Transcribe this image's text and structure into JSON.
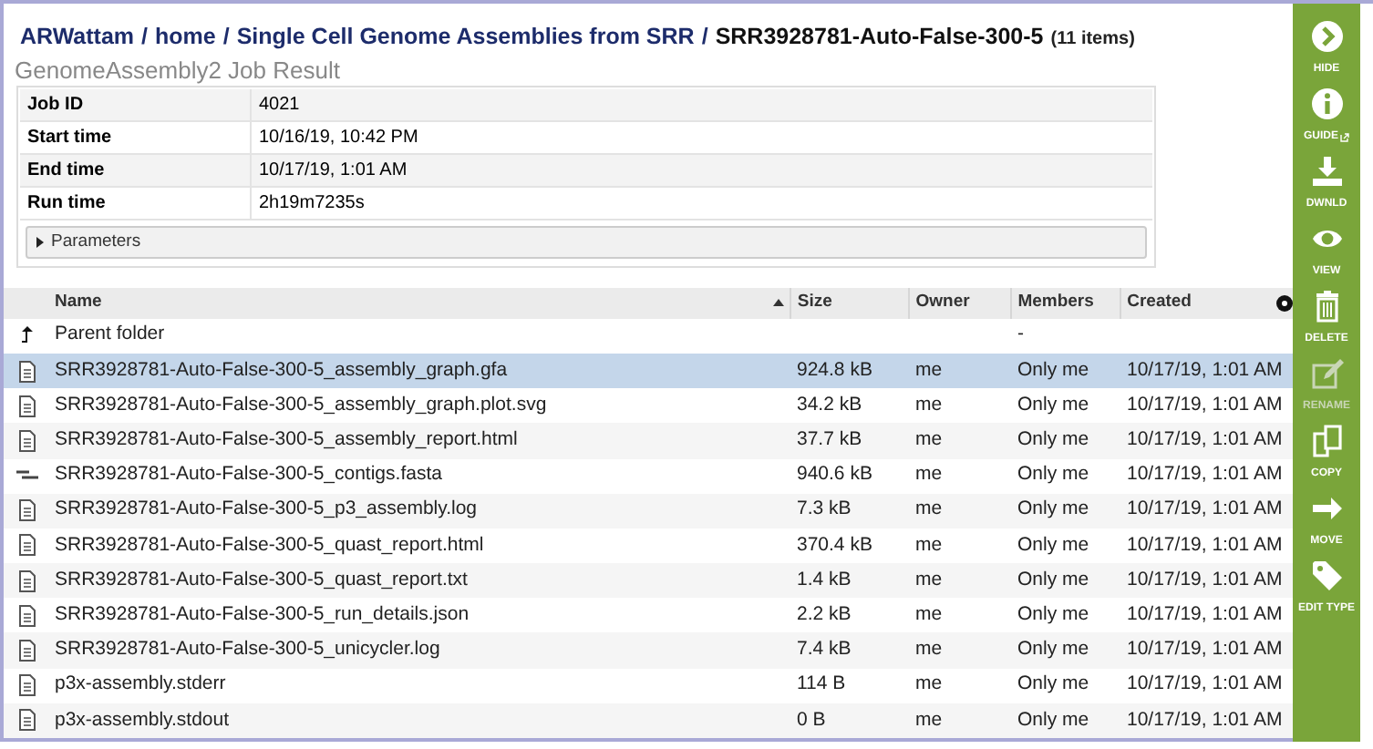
{
  "breadcrumb": {
    "path": [
      {
        "label": "ARWattam"
      },
      {
        "label": "home"
      },
      {
        "label": "Single Cell Genome Assemblies from SRR"
      }
    ],
    "separator": "/",
    "current": "SRR3928781-Auto-False-300-5",
    "count": "(11 items)"
  },
  "job": {
    "title": "GenomeAssembly2 Job Result",
    "rows": [
      {
        "label": "Job ID",
        "value": "4021"
      },
      {
        "label": "Start time",
        "value": "10/16/19, 10:42 PM"
      },
      {
        "label": "End time",
        "value": "10/17/19, 1:01 AM"
      },
      {
        "label": "Run time",
        "value": "2h19m7235s"
      }
    ],
    "parameters": {
      "label": "Parameters",
      "expanded": false
    }
  },
  "table": {
    "columns": [
      {
        "label": "Name",
        "sorted": true
      },
      {
        "label": "Size",
        "sorted": false
      },
      {
        "label": "Owner",
        "sorted": false
      },
      {
        "label": "Members",
        "sorted": false
      },
      {
        "label": "Created",
        "sorted": false
      }
    ],
    "rows": [
      {
        "kind": "parent",
        "name": "Parent folder",
        "size": "",
        "owner": "",
        "members": "-",
        "created": "",
        "selected": false
      },
      {
        "kind": "file",
        "name": "SRR3928781-Auto-False-300-5_assembly_graph.gfa",
        "size": "924.8 kB",
        "owner": "me",
        "members": "Only me",
        "created": "10/17/19, 1:01 AM",
        "selected": true
      },
      {
        "kind": "file",
        "name": "SRR3928781-Auto-False-300-5_assembly_graph.plot.svg",
        "size": "34.2 kB",
        "owner": "me",
        "members": "Only me",
        "created": "10/17/19, 1:01 AM",
        "selected": false
      },
      {
        "kind": "file",
        "name": "SRR3928781-Auto-False-300-5_assembly_report.html",
        "size": "37.7 kB",
        "owner": "me",
        "members": "Only me",
        "created": "10/17/19, 1:01 AM",
        "selected": false
      },
      {
        "kind": "contigs",
        "name": "SRR3928781-Auto-False-300-5_contigs.fasta",
        "size": "940.6 kB",
        "owner": "me",
        "members": "Only me",
        "created": "10/17/19, 1:01 AM",
        "selected": false
      },
      {
        "kind": "file",
        "name": "SRR3928781-Auto-False-300-5_p3_assembly.log",
        "size": "7.3 kB",
        "owner": "me",
        "members": "Only me",
        "created": "10/17/19, 1:01 AM",
        "selected": false
      },
      {
        "kind": "file",
        "name": "SRR3928781-Auto-False-300-5_quast_report.html",
        "size": "370.4 kB",
        "owner": "me",
        "members": "Only me",
        "created": "10/17/19, 1:01 AM",
        "selected": false
      },
      {
        "kind": "file",
        "name": "SRR3928781-Auto-False-300-5_quast_report.txt",
        "size": "1.4 kB",
        "owner": "me",
        "members": "Only me",
        "created": "10/17/19, 1:01 AM",
        "selected": false
      },
      {
        "kind": "file",
        "name": "SRR3928781-Auto-False-300-5_run_details.json",
        "size": "2.2 kB",
        "owner": "me",
        "members": "Only me",
        "created": "10/17/19, 1:01 AM",
        "selected": false
      },
      {
        "kind": "file",
        "name": "SRR3928781-Auto-False-300-5_unicycler.log",
        "size": "7.4 kB",
        "owner": "me",
        "members": "Only me",
        "created": "10/17/19, 1:01 AM",
        "selected": false
      },
      {
        "kind": "file",
        "name": "p3x-assembly.stderr",
        "size": "114 B",
        "owner": "me",
        "members": "Only me",
        "created": "10/17/19, 1:01 AM",
        "selected": false
      },
      {
        "kind": "file",
        "name": "p3x-assembly.stdout",
        "size": "0 B",
        "owner": "me",
        "members": "Only me",
        "created": "10/17/19, 1:01 AM",
        "selected": false
      }
    ]
  },
  "actions": [
    {
      "kind": "hide",
      "label": "HIDE",
      "disabled": false
    },
    {
      "kind": "guide",
      "label": "GUIDE",
      "disabled": false
    },
    {
      "kind": "download",
      "label": "DWNLD",
      "disabled": false
    },
    {
      "kind": "view",
      "label": "VIEW",
      "disabled": false
    },
    {
      "kind": "delete",
      "label": "DELETE",
      "disabled": false
    },
    {
      "kind": "rename",
      "label": "RENAME",
      "disabled": true
    },
    {
      "kind": "copy",
      "label": "COPY",
      "disabled": false
    },
    {
      "kind": "move",
      "label": "MOVE",
      "disabled": false
    },
    {
      "kind": "edittype",
      "label": "EDIT TYPE",
      "disabled": false
    }
  ]
}
